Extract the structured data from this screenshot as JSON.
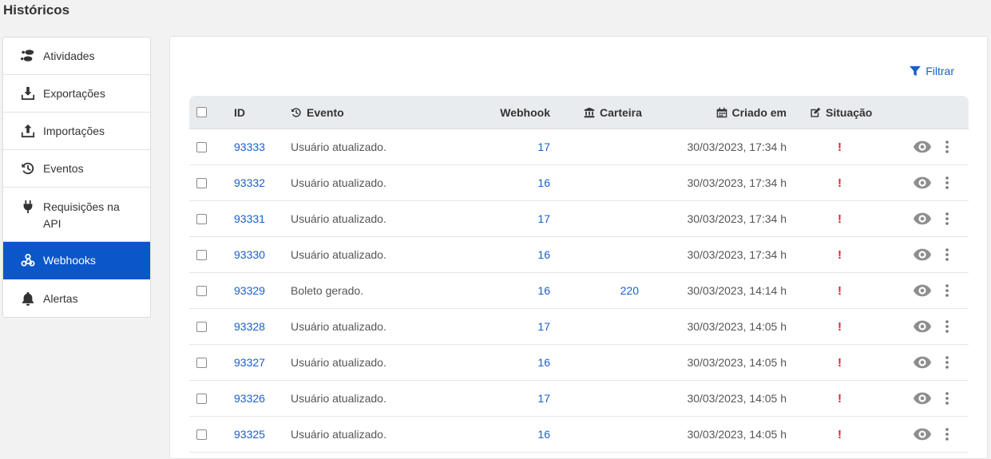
{
  "page": {
    "title": "Históricos"
  },
  "sidebar": {
    "items": [
      {
        "label": "Atividades",
        "icon": "footprints-icon"
      },
      {
        "label": "Exportações",
        "icon": "download-icon"
      },
      {
        "label": "Importações",
        "icon": "upload-icon"
      },
      {
        "label": "Eventos",
        "icon": "history-icon"
      },
      {
        "label": "Requisições na API",
        "icon": "plug-icon"
      },
      {
        "label": "Webhooks",
        "icon": "webhook-icon",
        "active": true
      },
      {
        "label": "Alertas",
        "icon": "bell-icon"
      }
    ]
  },
  "toolbar": {
    "filter_label": "Filtrar"
  },
  "table": {
    "headers": {
      "id": "ID",
      "evento": "Evento",
      "webhook": "Webhook",
      "carteira": "Carteira",
      "criado_em": "Criado em",
      "situacao": "Situação"
    },
    "rows": [
      {
        "id": "93333",
        "evento": "Usuário atualizado.",
        "webhook": "17",
        "carteira": "",
        "criado_em": "30/03/2023, 17:34 h",
        "situacao": "!"
      },
      {
        "id": "93332",
        "evento": "Usuário atualizado.",
        "webhook": "16",
        "carteira": "",
        "criado_em": "30/03/2023, 17:34 h",
        "situacao": "!"
      },
      {
        "id": "93331",
        "evento": "Usuário atualizado.",
        "webhook": "17",
        "carteira": "",
        "criado_em": "30/03/2023, 17:34 h",
        "situacao": "!"
      },
      {
        "id": "93330",
        "evento": "Usuário atualizado.",
        "webhook": "16",
        "carteira": "",
        "criado_em": "30/03/2023, 17:34 h",
        "situacao": "!"
      },
      {
        "id": "93329",
        "evento": "Boleto gerado.",
        "webhook": "16",
        "carteira": "220",
        "criado_em": "30/03/2023, 14:14 h",
        "situacao": "!"
      },
      {
        "id": "93328",
        "evento": "Usuário atualizado.",
        "webhook": "17",
        "carteira": "",
        "criado_em": "30/03/2023, 14:05 h",
        "situacao": "!"
      },
      {
        "id": "93327",
        "evento": "Usuário atualizado.",
        "webhook": "16",
        "carteira": "",
        "criado_em": "30/03/2023, 14:05 h",
        "situacao": "!"
      },
      {
        "id": "93326",
        "evento": "Usuário atualizado.",
        "webhook": "17",
        "carteira": "",
        "criado_em": "30/03/2023, 14:05 h",
        "situacao": "!"
      },
      {
        "id": "93325",
        "evento": "Usuário atualizado.",
        "webhook": "16",
        "carteira": "",
        "criado_em": "30/03/2023, 14:05 h",
        "situacao": "!"
      }
    ]
  },
  "colors": {
    "accent": "#0b57c9",
    "link": "#1a5fc7",
    "error": "#e0202a"
  }
}
